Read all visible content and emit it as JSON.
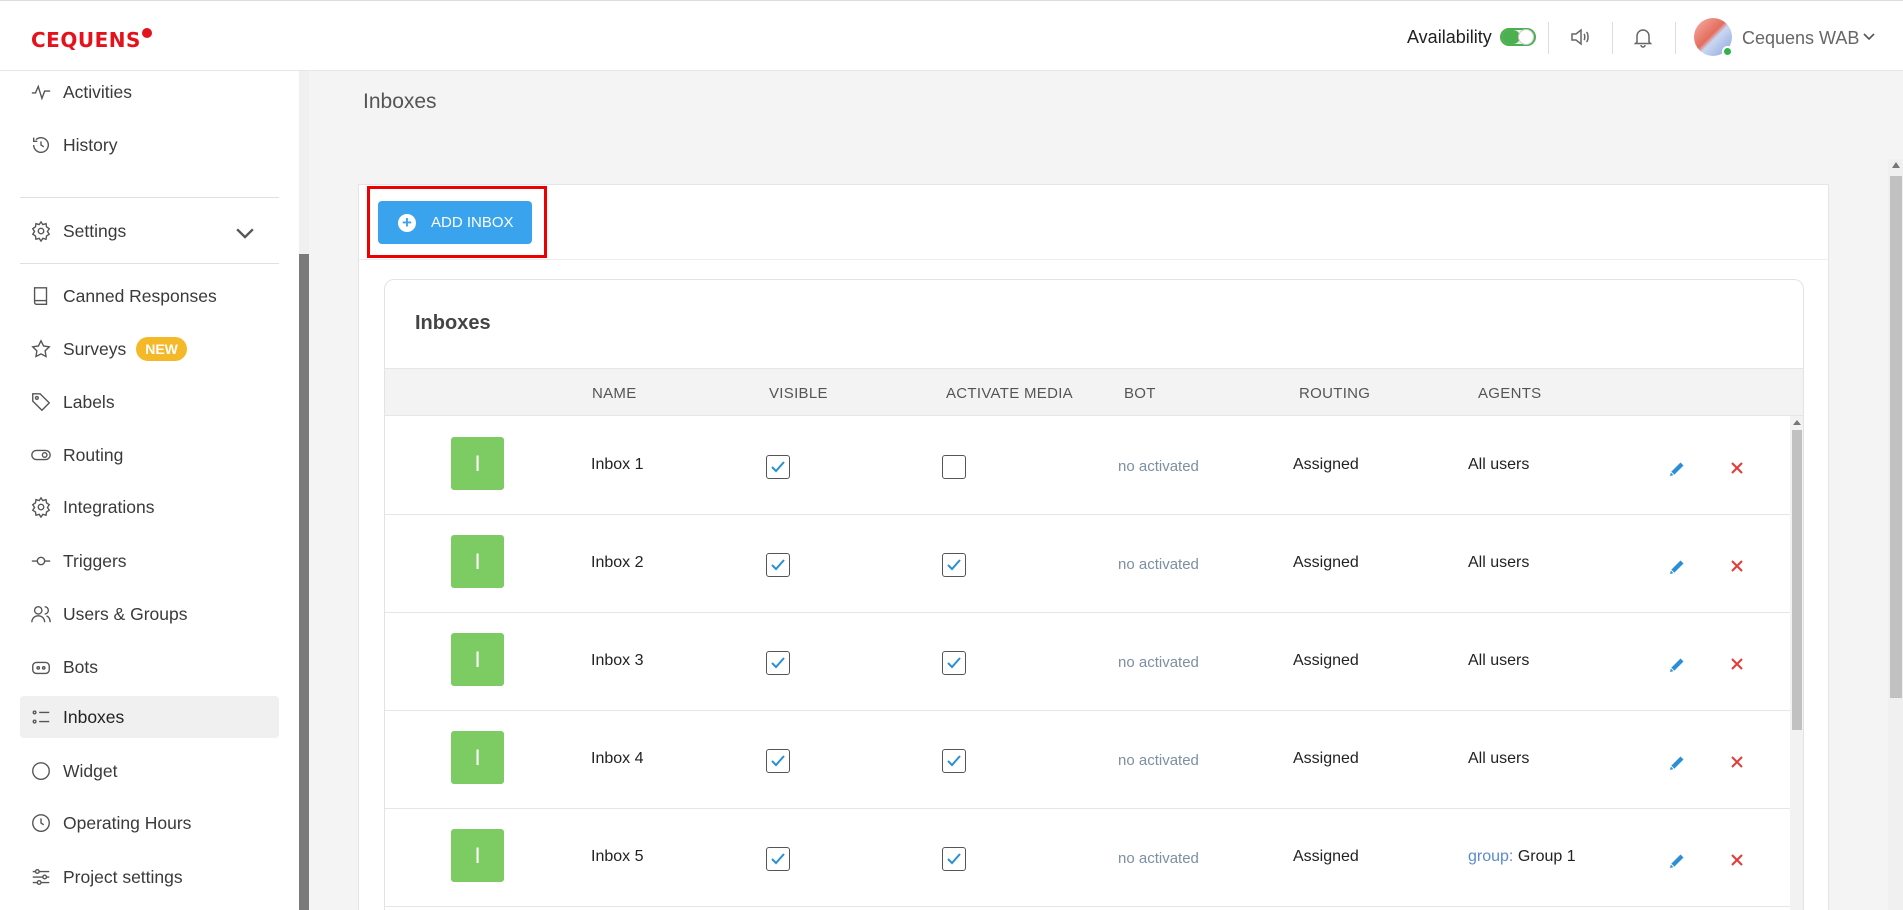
{
  "header": {
    "logo_text": "CEQUENS",
    "availability_label": "Availability",
    "user_name": "Cequens WAB"
  },
  "sidebar": {
    "items": [
      {
        "label": "Activities",
        "icon": "activity-icon"
      },
      {
        "label": "History",
        "icon": "history-icon"
      },
      {
        "label": "Settings",
        "icon": "gear-icon"
      },
      {
        "label": "Canned Responses",
        "icon": "book-icon"
      },
      {
        "label": "Surveys",
        "icon": "star-icon",
        "badge": "NEW"
      },
      {
        "label": "Labels",
        "icon": "tag-icon"
      },
      {
        "label": "Routing",
        "icon": "toggle-icon"
      },
      {
        "label": "Integrations",
        "icon": "gear-icon"
      },
      {
        "label": "Triggers",
        "icon": "trigger-icon"
      },
      {
        "label": "Users & Groups",
        "icon": "users-icon"
      },
      {
        "label": "Bots",
        "icon": "bot-icon"
      },
      {
        "label": "Inboxes",
        "icon": "list-icon"
      },
      {
        "label": "Widget",
        "icon": "circle-icon"
      },
      {
        "label": "Operating Hours",
        "icon": "clock-icon"
      },
      {
        "label": "Project settings",
        "icon": "sliders-icon"
      }
    ],
    "active": "Inboxes"
  },
  "main": {
    "page_title": "Inboxes",
    "add_button_label": "ADD INBOX",
    "table_title": "Inboxes",
    "columns": [
      "NAME",
      "VISIBLE",
      "ACTIVATE MEDIA",
      "BOT",
      "ROUTING",
      "AGENTS"
    ],
    "rows": [
      {
        "initial": "I",
        "name": "Inbox 1",
        "visible": true,
        "media": false,
        "bot": "no activated",
        "routing": "Assigned",
        "agents_prefix": "",
        "agents": "All users"
      },
      {
        "initial": "I",
        "name": "Inbox 2",
        "visible": true,
        "media": true,
        "bot": "no activated",
        "routing": "Assigned",
        "agents_prefix": "",
        "agents": "All users"
      },
      {
        "initial": "I",
        "name": "Inbox 3",
        "visible": true,
        "media": true,
        "bot": "no activated",
        "routing": "Assigned",
        "agents_prefix": "",
        "agents": "All users"
      },
      {
        "initial": "I",
        "name": "Inbox 4",
        "visible": true,
        "media": true,
        "bot": "no activated",
        "routing": "Assigned",
        "agents_prefix": "",
        "agents": "All users"
      },
      {
        "initial": "I",
        "name": "Inbox 5",
        "visible": true,
        "media": true,
        "bot": "no activated",
        "routing": "Assigned",
        "agents_prefix": "group:",
        "agents": "Group 1"
      }
    ]
  },
  "colors": {
    "brand_red": "#e3121c",
    "primary_blue": "#3aa3ee",
    "inbox_green": "#7dcc63",
    "delete_red": "#e53935",
    "badge_yellow": "#f5b828"
  }
}
